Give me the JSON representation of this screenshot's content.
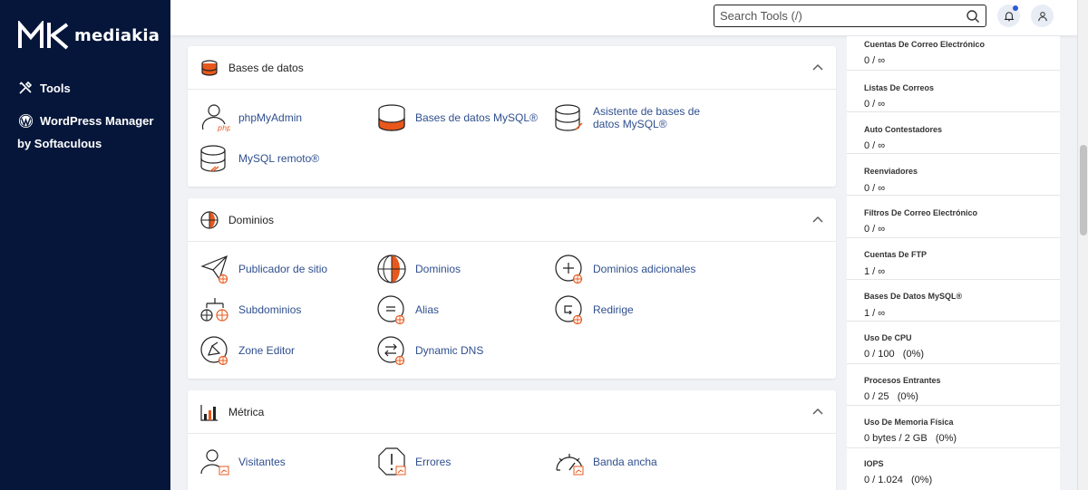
{
  "brand": {
    "name": "mediakia"
  },
  "sidebar": {
    "items": [
      {
        "label": "Tools",
        "icon": "tools-icon"
      },
      {
        "label": "WordPress Manager by Softaculous",
        "icon": "wordpress-icon"
      }
    ]
  },
  "topbar": {
    "search_placeholder": "Search Tools (/)",
    "search_value": ""
  },
  "sections": [
    {
      "title": "Bases de datos",
      "icon": "database-icon",
      "tools": [
        {
          "label": "phpMyAdmin",
          "icon": "phpmyadmin-icon"
        },
        {
          "label": "Bases de datos MySQL®",
          "icon": "mysql-databases-icon"
        },
        {
          "label": "Asistente de bases de datos MySQL®",
          "icon": "database-wizard-icon"
        },
        {
          "label": "MySQL remoto®",
          "icon": "remote-mysql-icon"
        }
      ]
    },
    {
      "title": "Dominios",
      "icon": "globe-icon",
      "tools": [
        {
          "label": "Publicador de sitio",
          "icon": "site-publisher-icon"
        },
        {
          "label": "Dominios",
          "icon": "domains-icon"
        },
        {
          "label": "Dominios adicionales",
          "icon": "addon-domains-icon"
        },
        {
          "label": "Subdominios",
          "icon": "subdomains-icon"
        },
        {
          "label": "Alias",
          "icon": "aliases-icon"
        },
        {
          "label": "Redirige",
          "icon": "redirects-icon"
        },
        {
          "label": "Zone Editor",
          "icon": "zone-editor-icon"
        },
        {
          "label": "Dynamic DNS",
          "icon": "dynamic-dns-icon"
        }
      ]
    },
    {
      "title": "Métrica",
      "icon": "metrics-icon",
      "tools": [
        {
          "label": "Visitantes",
          "icon": "visitors-icon"
        },
        {
          "label": "Errores",
          "icon": "errors-icon"
        },
        {
          "label": "Banda ancha",
          "icon": "bandwidth-icon"
        }
      ]
    }
  ],
  "stats": [
    {
      "label": "Cuentas De Correo Electrónico",
      "value": "0 / ∞"
    },
    {
      "label": "Listas De Correos",
      "value": "0 / ∞"
    },
    {
      "label": "Auto Contestadores",
      "value": "0 / ∞"
    },
    {
      "label": "Reenviadores",
      "value": "0 / ∞"
    },
    {
      "label": "Filtros De Correo Electrónico",
      "value": "0 / ∞"
    },
    {
      "label": "Cuentas De FTP",
      "value": "1 / ∞"
    },
    {
      "label": "Bases De Datos MySQL®",
      "value": "1 / ∞"
    },
    {
      "label": "Uso De CPU",
      "value": "0 / 100   (0%)"
    },
    {
      "label": "Procesos Entrantes",
      "value": "0 / 25   (0%)"
    },
    {
      "label": "Uso De Memoria Física",
      "value": "0 bytes / 2 GB   (0%)"
    },
    {
      "label": "IOPS",
      "value": "0 / 1.024   (0%)"
    }
  ],
  "colors": {
    "sidebar": "#06163a",
    "accent": "#e8581c",
    "link": "#2f4f8f"
  }
}
